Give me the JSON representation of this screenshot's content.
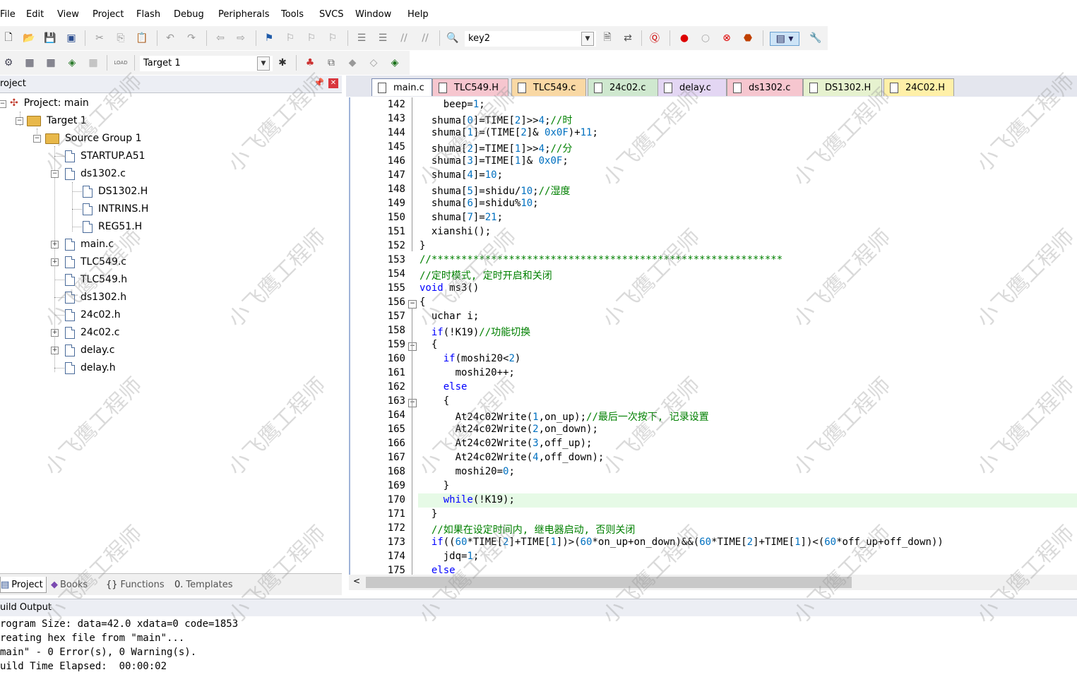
{
  "menu": [
    "File",
    "Edit",
    "View",
    "Project",
    "Flash",
    "Debug",
    "Peripherals",
    "Tools",
    "SVCS",
    "Window",
    "Help"
  ],
  "toolbar1": {
    "find_combo": "key2"
  },
  "toolbar2": {
    "target_combo": "Target 1",
    "load_label": "LOAD"
  },
  "project_panel": {
    "title": "roject",
    "tree": {
      "project": "Project: main",
      "target": "Target 1",
      "group": "Source Group 1",
      "files": [
        "STARTUP.A51",
        "ds1302.c",
        "DS1302.H",
        "INTRINS.H",
        "REG51.H",
        "main.c",
        "TLC549.c",
        "TLC549.h",
        "ds1302.h",
        "24c02.h",
        "24c02.c",
        "delay.c",
        "delay.h"
      ]
    },
    "tabs": [
      "Project",
      "Books",
      "Functions",
      "Templates"
    ]
  },
  "editor": {
    "tabs": [
      "main.c",
      "TLC549.H",
      "TLC549.c",
      "24c02.c",
      "delay.c",
      "ds1302.c",
      "DS1302.H",
      "24C02.H"
    ],
    "tab_colors": [
      "#ffffff",
      "#f6c6cf",
      "#f9d8a4",
      "#cfe8cf",
      "#e3d6f3",
      "#f6c6cf",
      "#e6f2cf",
      "#fff0a8"
    ],
    "line_numbers": [
      "142",
      "143",
      "144",
      "145",
      "146",
      "147",
      "148",
      "149",
      "150",
      "151",
      "152",
      "153",
      "154",
      "155",
      "156",
      "157",
      "158",
      "159",
      "160",
      "161",
      "162",
      "163",
      "164",
      "165",
      "166",
      "167",
      "168",
      "169",
      "170",
      "171",
      "172",
      "173",
      "174",
      "175"
    ],
    "lines": [
      "    beep=1;",
      "  shuma[0]=TIME[2]>>4;//时",
      "  shuma[1]=(TIME[2]& 0x0F)+11;",
      "  shuma[2]=TIME[1]>>4;//分",
      "  shuma[3]=TIME[1]& 0x0F;",
      "  shuma[4]=10;",
      "  shuma[5]=shidu/10;//湿度",
      "  shuma[6]=shidu%10;",
      "  shuma[7]=21;",
      "  xianshi();",
      "}",
      "//***********************************************************",
      "//定时模式, 定时开启和关闭",
      "void ms3()",
      "{",
      "  uchar i;",
      "  if(!K19)//功能切换",
      "  {",
      "    if(moshi20<2)",
      "      moshi20++;",
      "    else",
      "    {",
      "      At24c02Write(1,on_up);//最后一次按下, 记录设置",
      "      At24c02Write(2,on_down);",
      "      At24c02Write(3,off_up);",
      "      At24c02Write(4,off_down);",
      "      moshi20=0;",
      "    }",
      "    while(!K19);",
      "  }",
      "  //如果在设定时间内, 继电器启动, 否则关闭",
      "  if((60*TIME[2]+TIME[1])>(60*on_up+on_down)&&(60*TIME[2]+TIME[1])<(60*off_up+off_down))",
      "    jdq=1;",
      "  else"
    ]
  },
  "build_output": {
    "title": "uild Output",
    "lines": [
      "rogram Size: data=42.0 xdata=0 code=1853",
      "reating hex file from \"main\"...",
      "main\" - 0 Error(s), 0 Warning(s).",
      "uild Time Elapsed:  00:00:02"
    ]
  },
  "watermark": "小飞鹰工程师"
}
